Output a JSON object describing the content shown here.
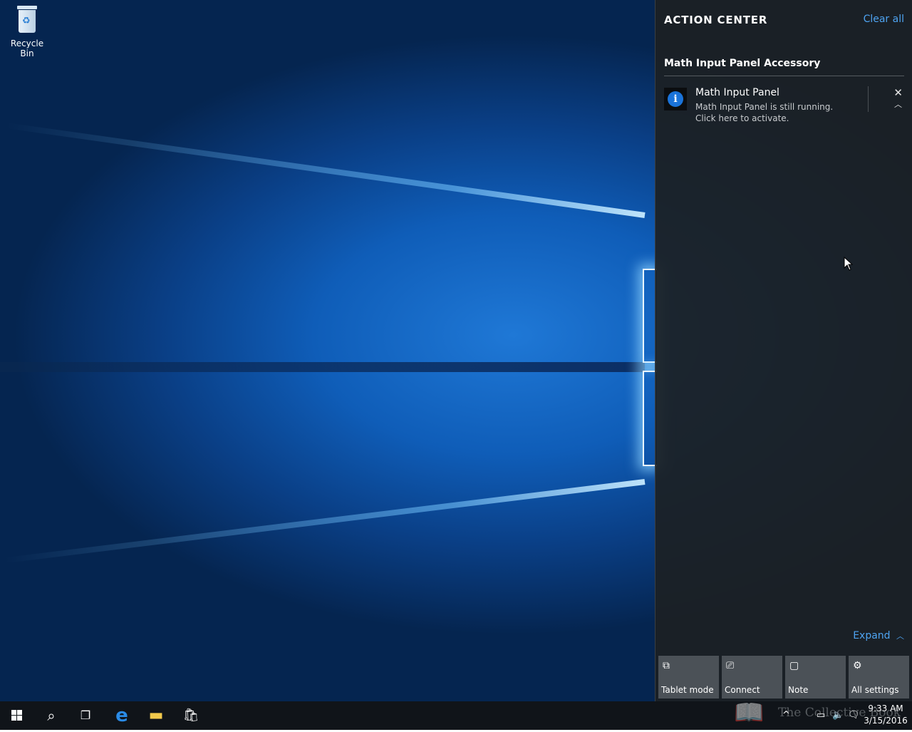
{
  "desktop": {
    "icons": [
      {
        "label": "Recycle Bin",
        "icon": "recycle-bin-icon"
      }
    ]
  },
  "action_center": {
    "title": "ACTION CENTER",
    "clear_all": "Clear all",
    "group": "Math Input Panel Accessory",
    "notification": {
      "icon": "info-icon",
      "icon_glyph": "i",
      "title": "Math Input Panel",
      "body_line1": "Math Input Panel is still running.",
      "body_line2": "Click here to activate.",
      "close_glyph": "✕",
      "collapse_glyph": "︿"
    },
    "expand": "Expand",
    "expand_glyph": "︿",
    "quick_actions": [
      {
        "label": "Tablet mode",
        "icon": "tablet-mode-icon",
        "glyph": "⧉"
      },
      {
        "label": "Connect",
        "icon": "connect-icon",
        "glyph": "⎚"
      },
      {
        "label": "Note",
        "icon": "note-icon",
        "glyph": "▢"
      },
      {
        "label": "All settings",
        "icon": "gear-icon",
        "glyph": "⚙"
      }
    ]
  },
  "taskbar": {
    "search_glyph": "⌕",
    "taskview_glyph": "❐",
    "edge_glyph": "e",
    "explorer_glyph": "▬",
    "store_glyph": "🛍",
    "watermark": "The Collective Book",
    "tray": {
      "chevron": "^",
      "network": "▭",
      "volume": "🔈",
      "action": "🗨"
    },
    "time": "9:33 AM",
    "date": "3/15/2016"
  },
  "colors": {
    "accent": "#4ea3f1",
    "panel": "#1c2024",
    "tile": "#4b5157",
    "taskbar": "#101419"
  }
}
